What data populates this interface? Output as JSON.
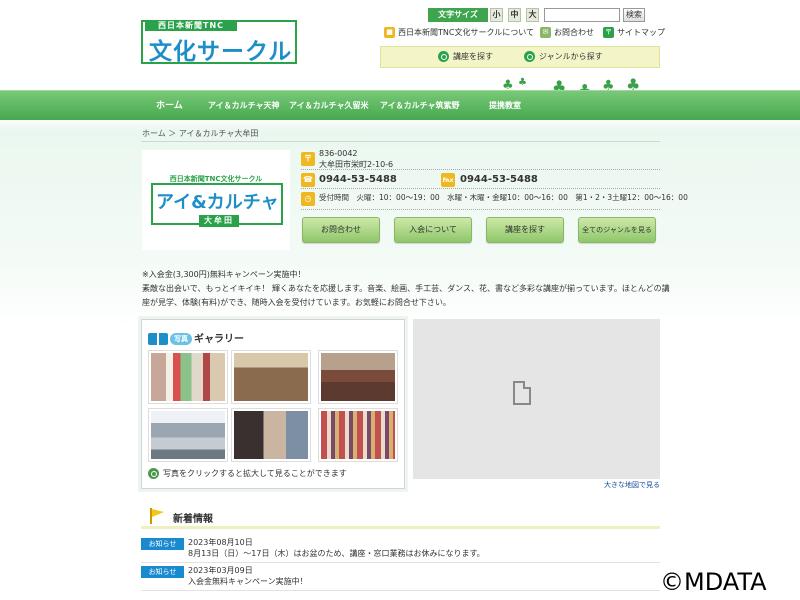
{
  "header": {
    "logo_sub": "西日本新聞TNC",
    "logo_main": "文化サークル",
    "font_size_label": "文字サイズ",
    "font_sizes": [
      "小",
      "中",
      "大"
    ],
    "search_button": "検索",
    "search_placeholder": "",
    "util_links": [
      "西日本新聞TNC文化サークルについて",
      "お問合わせ",
      "サイトマップ"
    ],
    "subnav": [
      "講座を探す",
      "ジャンルから探す"
    ]
  },
  "nav": {
    "items": [
      "ホーム",
      "アイ＆カルチャ天神",
      "アイ＆カルチャ久留米",
      "アイ＆カルチャ筑紫野",
      "提携教室"
    ]
  },
  "breadcrumb": "ホーム ＞ アイ＆カルチャ大牟田",
  "shop": {
    "logo_sub": "西日本新聞TNC文化サークル",
    "logo_main": "アイ&カルチャ",
    "logo_city": "大牟田",
    "postal": "836-0042",
    "address": "大牟田市栄町2-10-6",
    "tel": "0944-53-5488",
    "fax": "0944-53-5488",
    "hours": "受付時間　火曜：10：00～19：00　水曜・木曜・金曜10：00～16：00　第1・2・3土曜12：00～16：00",
    "buttons": [
      "お問合わせ",
      "入会について",
      "講座を探す",
      "全てのジャンルを見る"
    ]
  },
  "intro": {
    "line1": "※入会金(3,300円)無料キャンペーン実施中！",
    "line2": "素敵な出会いで、もっとイキイキ！ 輝くあなたを応援します。音楽、絵画、手工芸、ダンス、花、書など多彩な講座が揃っています。ほとんどの講",
    "line3": "座が見学、体験(有料)ができ、随時入会を受付けています。お気軽にお問合せ下さい。"
  },
  "gallery": {
    "tag": "写真",
    "title": "ギャラリー",
    "note": "写真をクリックすると拡大して見ることができます"
  },
  "map": {
    "link": "大きな地図で見る"
  },
  "news": {
    "title": "新着情報",
    "items": [
      {
        "badge": "お知らせ",
        "date": "2023年08月10日",
        "text": "8月13日（日）～17日（木）はお盆のため、講座・窓口業務はお休みになります。"
      },
      {
        "badge": "お知らせ",
        "date": "2023年03月09日",
        "text": "入会金無料キャンペーン実施中！"
      }
    ]
  },
  "watermark": "©MDATA",
  "colors": {
    "green": "#2aa24a",
    "nav_green": "#45a84e",
    "blue": "#1e8ec9",
    "badge_blue": "#1a8ad0",
    "icon_yellow": "#f0b820"
  }
}
